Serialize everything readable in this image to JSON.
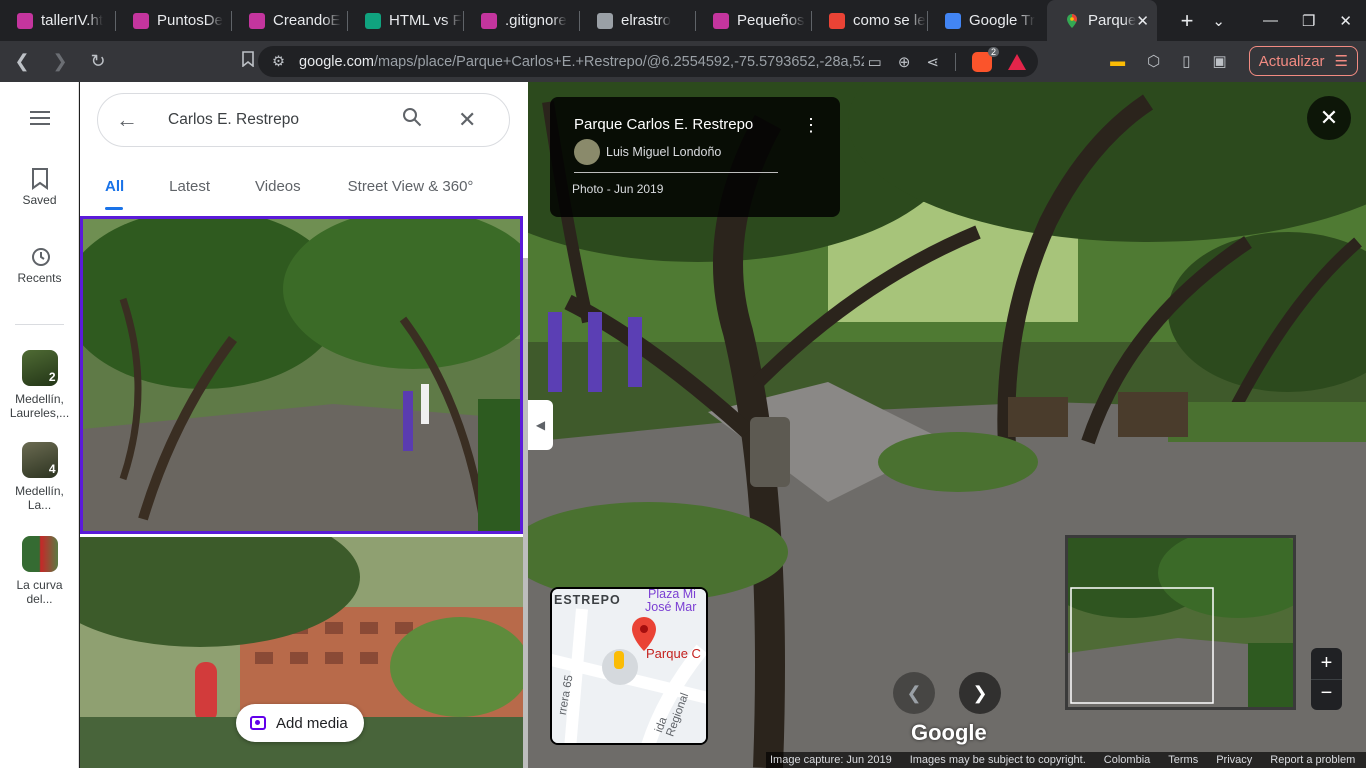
{
  "browser": {
    "tabs": [
      {
        "title": "tallerIV.ht",
        "icon": "purple-app-icon",
        "color": "#c4359e"
      },
      {
        "title": "PuntosDe",
        "icon": "purple-app-icon",
        "color": "#c4359e"
      },
      {
        "title": "CreandoE",
        "icon": "purple-app-icon",
        "color": "#c4359e"
      },
      {
        "title": "HTML vs F",
        "icon": "chatgpt-icon",
        "color": "#10a37f"
      },
      {
        "title": ".gitignore",
        "icon": "purple-app-icon",
        "color": "#c4359e"
      },
      {
        "title": "elrastro",
        "icon": "globe-icon",
        "color": "#9aa0a6"
      },
      {
        "title": "Pequeños",
        "icon": "purple-app-icon",
        "color": "#c4359e"
      },
      {
        "title": "como se le",
        "icon": "red-app-icon",
        "color": "#ea4335"
      },
      {
        "title": "Google Tr",
        "icon": "google-translate-icon",
        "color": "#4285f4"
      }
    ],
    "active_tab": {
      "title": "Parque",
      "icon": "google-maps-icon"
    },
    "url_host": "google.com",
    "url_path": "/maps/place/Parque+Carlos+E.+Restrepo/@6.2554592,-75.5793652,-28a,52....",
    "brave_count": "2",
    "update_label": "Actualizar"
  },
  "rail": {
    "saved": "Saved",
    "recents": "Recents",
    "items": [
      {
        "label1": "Medellín,",
        "label2": "Laureles,...",
        "badge": "2"
      },
      {
        "label1": "Medellín,",
        "label2": "La...",
        "badge": "4"
      },
      {
        "label1": "La curva",
        "label2": "del...",
        "badge": ""
      }
    ]
  },
  "panel": {
    "search_value": "Carlos E. Restrepo",
    "tabs": [
      "All",
      "Latest",
      "Videos",
      "Street View & 360°"
    ],
    "add_media": "Add media"
  },
  "viewer": {
    "place_title": "Parque Carlos E. Restrepo",
    "author": "Luis Miguel Londoño",
    "photo_date": "Photo - Jun 2019",
    "google": "Google",
    "minimap": {
      "label1": "ESTREPO",
      "label2": "Plaza Mi",
      "label3": "José Mar",
      "label4": "Parque C",
      "road1": "rrera 65",
      "road2": "ida Regional"
    },
    "footer": [
      "Image capture: Jun 2019",
      "Images may be subject to copyright.",
      "Colombia",
      "Terms",
      "Privacy",
      "Report a problem"
    ]
  },
  "colors": {
    "accent": "#1a73e8",
    "selection": "#5b1bd9",
    "update": "#f28b82"
  }
}
